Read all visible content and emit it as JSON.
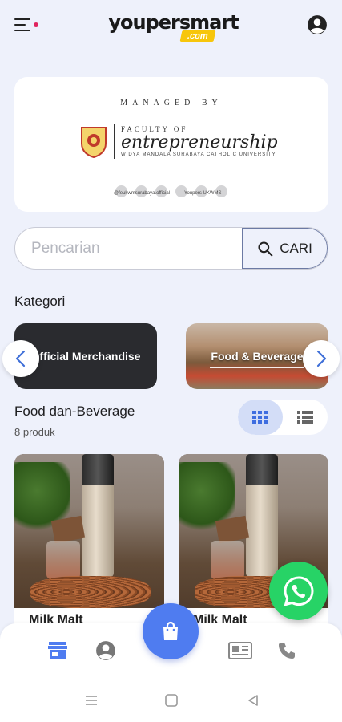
{
  "header": {
    "logo_main": "youpersmart",
    "logo_badge": ".com"
  },
  "banner": {
    "managed_by": "MANAGED BY",
    "faculty_line": "FACULTY OF",
    "faculty_name": "entrepreneurship",
    "university": "WIDYA MANDALA SURABAYA CATHOLIC UNIVERSITY",
    "social_instagram": "@feukwmsurabaya.official",
    "social_youtube": "Youpers UKWMS"
  },
  "search": {
    "placeholder": "Pencarian",
    "button_label": "CARI"
  },
  "categories": {
    "title": "Kategori",
    "items": [
      {
        "label": "Official Merchandise"
      },
      {
        "label": "Food & Beverage"
      }
    ]
  },
  "products": {
    "title": "Food dan-Beverage",
    "count": "8 produk",
    "items": [
      {
        "caption": "Milk Malt"
      },
      {
        "caption": "Milk Malt"
      }
    ]
  },
  "colors": {
    "accent": "#4f7cf0",
    "whatsapp": "#27d366",
    "logo_badge": "#f7c60b"
  },
  "icons": {
    "menu": "menu-icon",
    "account": "account-circle-icon",
    "search": "search-icon",
    "grid_view": "grid-view-icon",
    "list_view": "list-view-icon",
    "whatsapp": "whatsapp-icon",
    "store": "store-icon",
    "profile": "person-icon",
    "bag": "shopping-bag-icon",
    "news": "newspaper-icon",
    "phone": "phone-icon"
  }
}
